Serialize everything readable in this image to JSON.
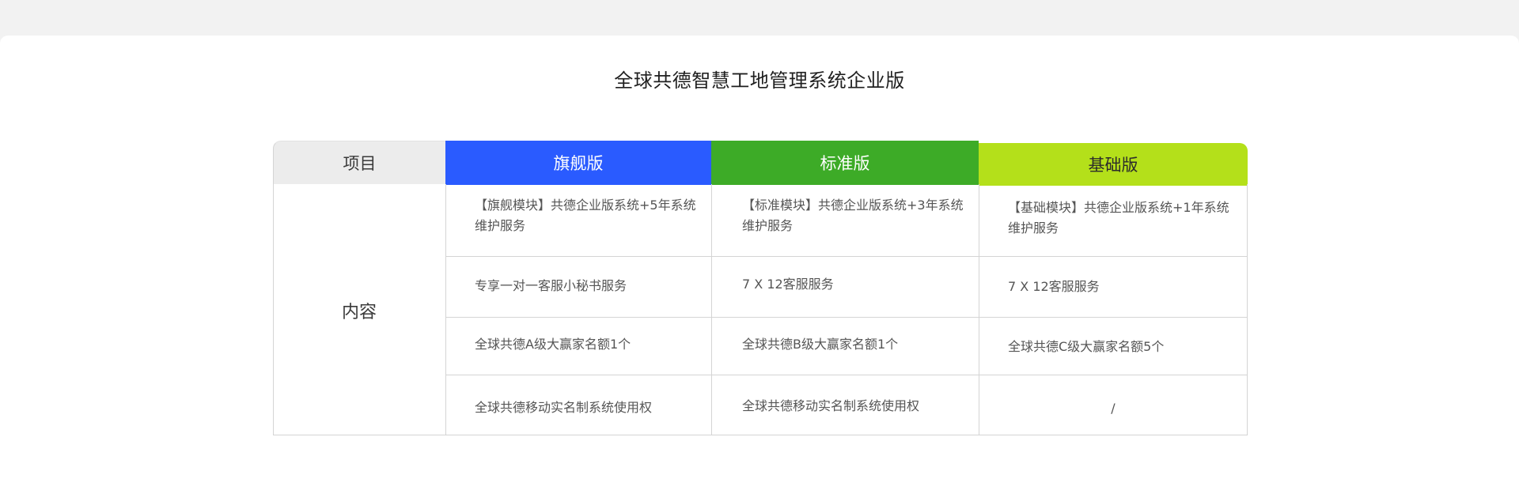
{
  "page": {
    "title": "全球共德智慧工地管理系统企业版"
  },
  "table": {
    "headers": {
      "project": "项目",
      "flagship": "旗舰版",
      "standard": "标准版",
      "basic": "基础版"
    },
    "row_label": "内容",
    "columns": {
      "flagship": [
        "【旗舰模块】共德企业版系统+5年系统维护服务",
        "专享一对一客服小秘书服务",
        "全球共德A级大赢家名额1个",
        "全球共德移动实名制系统使用权"
      ],
      "standard": [
        "【标准模块】共德企业版系统+3年系统维护服务",
        "7 X 12客服服务",
        "全球共德B级大赢家名额1个",
        "全球共德移动实名制系统使用权"
      ],
      "basic": [
        "【基础模块】共德企业版系统+1年系统维护服务",
        "7 X 12客服服务",
        "全球共德C级大赢家名额5个",
        "/"
      ]
    }
  },
  "colors": {
    "flagship": "#2a5bff",
    "standard": "#3dab27",
    "basic": "#b4e01a",
    "project_header": "#ececec"
  }
}
